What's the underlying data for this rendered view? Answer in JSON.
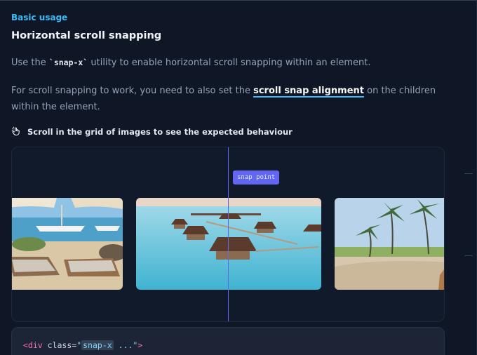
{
  "section": {
    "eyebrow": "Basic usage",
    "title": "Horizontal scroll snapping"
  },
  "paragraph1": {
    "before": "Use the ",
    "code": "`snap-x`",
    "after": " utility to enable horizontal scroll snapping within an element."
  },
  "paragraph2": {
    "before": "For scroll snapping to work, you need to also set the ",
    "link": "scroll snap alignment",
    "after": " on the children within the element."
  },
  "hint": {
    "icon": "hand-pointer-icon",
    "text": "Scroll in the grid of images to see the expected behaviour"
  },
  "demo": {
    "snap_label": "snap point",
    "accent": "#6366f1",
    "images": [
      {
        "name": "beach-chairs-image"
      },
      {
        "name": "overwater-bungalows-image"
      },
      {
        "name": "palm-beach-image"
      }
    ]
  },
  "code": {
    "tag_open": "<div",
    "attr": " class=",
    "quote_open": "\"",
    "value_hl": "snap-x",
    "value_rest": " ...",
    "quote_close": "\"",
    "tag_close": ">"
  }
}
